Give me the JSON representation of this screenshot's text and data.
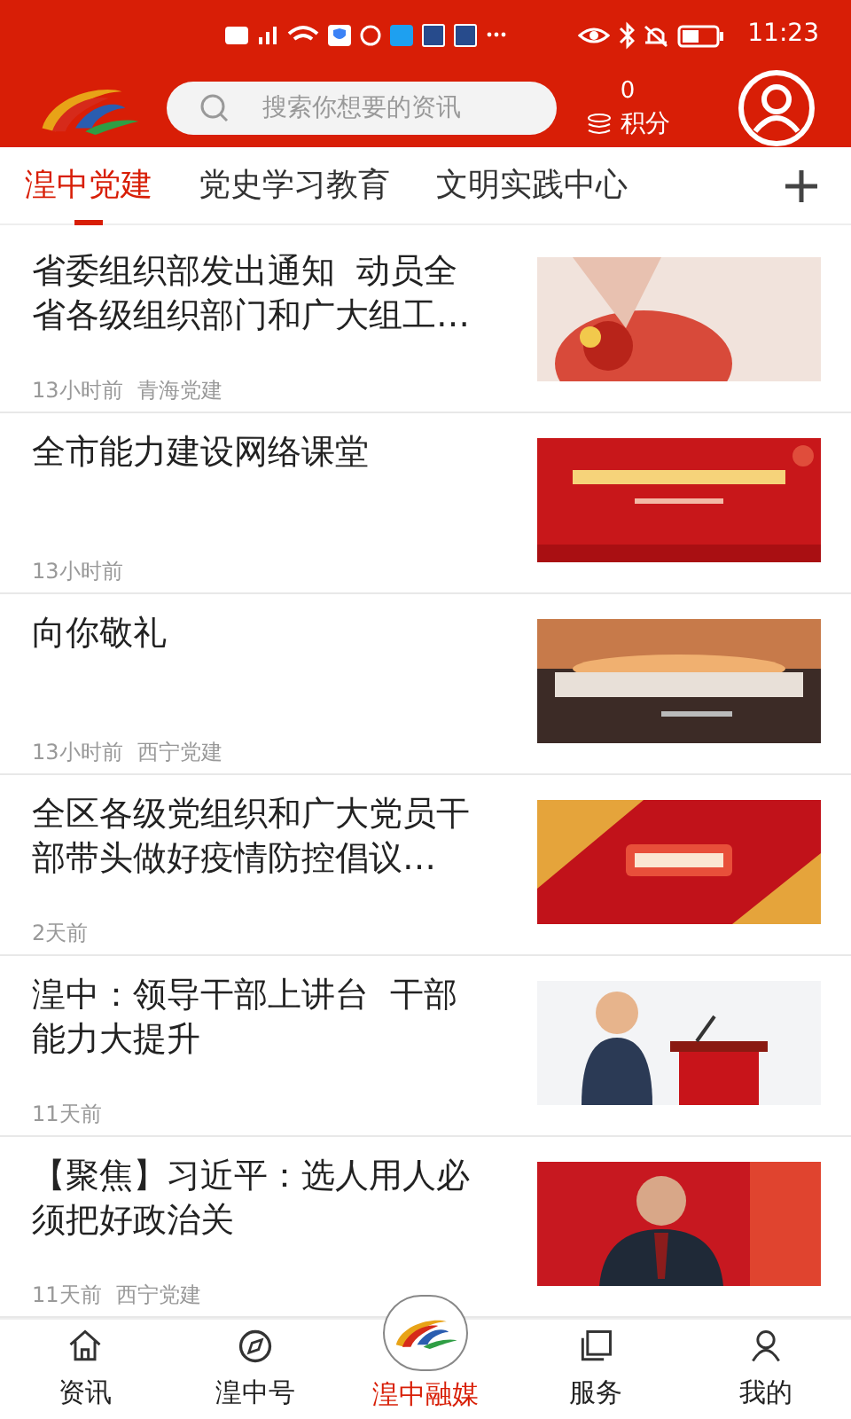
{
  "status_bar": {
    "time": "11:23"
  },
  "header": {
    "search": {
      "placeholder": "搜索你想要的资讯"
    },
    "points": {
      "value": "0",
      "label": "积分"
    }
  },
  "tabs": [
    {
      "label": "湟中党建",
      "selected": true
    },
    {
      "label": "党史学习教育",
      "selected": false
    },
    {
      "label": "文明实践中心",
      "selected": false
    }
  ],
  "articles": [
    {
      "title": "省委组织部发出通知  动员全省各级组织部门和广大组工…",
      "time": "13小时前",
      "source": "青海党建"
    },
    {
      "title": "全市能力建设网络课堂",
      "time": "13小时前"
    },
    {
      "title": "向你敬礼",
      "time": "13小时前",
      "source": "西宁党建"
    },
    {
      "title": "全区各级党组织和广大党员干部带头做好疫情防控倡议…",
      "time": "2天前"
    },
    {
      "title": "湟中：领导干部上讲台  干部能力大提升",
      "time": "11天前"
    },
    {
      "title": "【聚焦】习近平：选人用人必须把好政治关",
      "time": "11天前",
      "source": "西宁党建"
    }
  ],
  "bottom_nav": [
    {
      "label": "资讯",
      "kind": "home",
      "selected": false
    },
    {
      "label": "湟中号",
      "kind": "compass",
      "selected": false
    },
    {
      "label": "湟中融媒",
      "kind": "logo",
      "selected": true
    },
    {
      "label": "服务",
      "kind": "pages",
      "selected": false
    },
    {
      "label": "我的",
      "kind": "person",
      "selected": false
    }
  ]
}
